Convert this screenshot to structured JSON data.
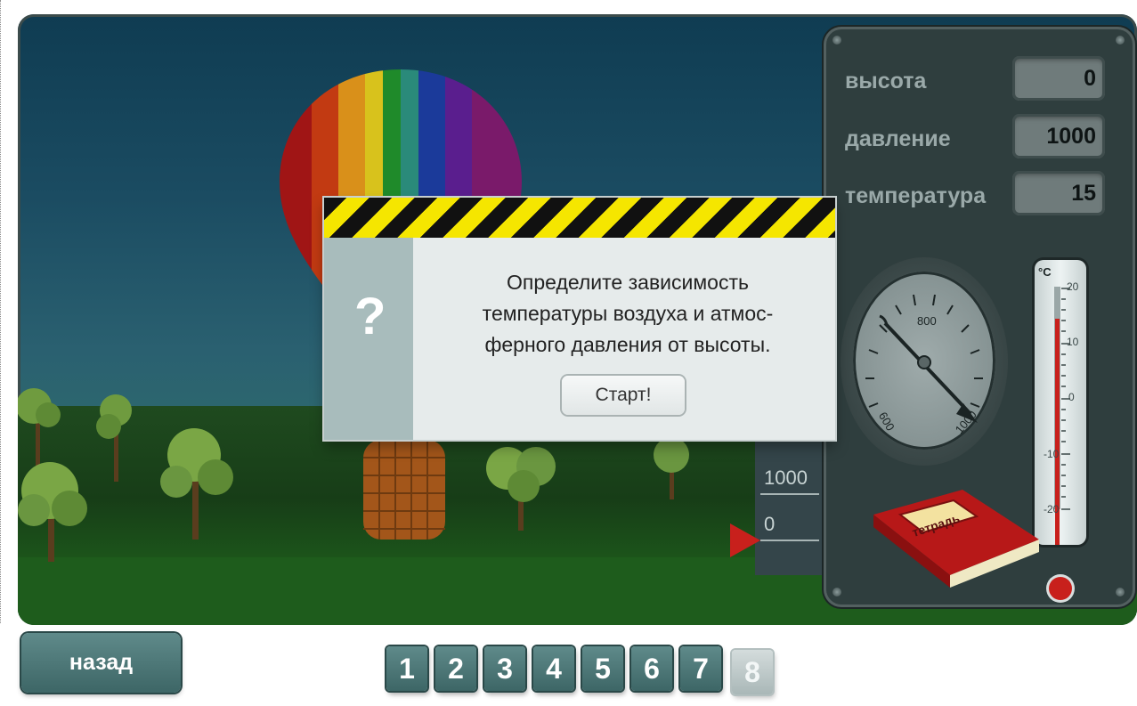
{
  "panel": {
    "altitude_label": "высота",
    "altitude_value": "0",
    "pressure_label": "давление",
    "pressure_value": "1000",
    "temperature_label": "температура",
    "temperature_value": "15"
  },
  "gauge": {
    "label_800": "800",
    "label_600": "600",
    "label_1000": "1000",
    "value": 1000
  },
  "thermometer": {
    "unit": "°C",
    "ticks": [
      "20",
      "10",
      "0",
      "-10",
      "-20"
    ],
    "value": 15
  },
  "ruler": {
    "mark_1000": "1000",
    "mark_0": "0"
  },
  "notebook": {
    "label": "тетрадь"
  },
  "modal": {
    "icon": "?",
    "line1": "Определите зависимость",
    "line2": "температуры воздуха и атмос-",
    "line3": "ферного давления от высоты.",
    "start_label": "Старт!"
  },
  "nav": {
    "back_label": "назад",
    "pages": [
      "1",
      "2",
      "3",
      "4",
      "5",
      "6",
      "7",
      "8"
    ],
    "current_page": "8"
  },
  "colors": {
    "hazard_yellow": "#f5e600",
    "hazard_black": "#111111",
    "button_teal": "#4a7474",
    "mercury_red": "#c8201c"
  }
}
